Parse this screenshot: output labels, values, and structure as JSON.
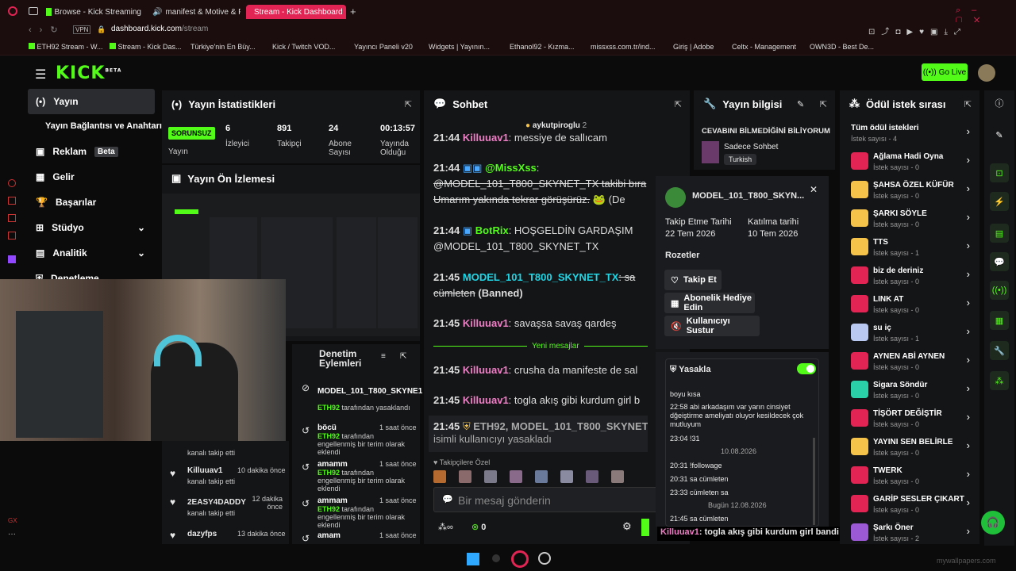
{
  "browser": {
    "tabs": [
      {
        "label": "Browse - Kick Streaming"
      },
      {
        "label": "manifest & Motive & Pa"
      },
      {
        "label": "Stream - Kick Dashboard"
      }
    ],
    "url_host": "dashboard.kick.com",
    "url_path": "/stream",
    "bookmarks": [
      "ETH92 Stream - W...",
      "Stream - Kick Das...",
      "Türkiye'nin En Büy...",
      "Kick / Twitch VOD...",
      "Yayıncı Paneli v20",
      "Widgets | Yayının...",
      "Ethanol92 - Kızma...",
      "missxss.com.tr/ind...",
      "Giriş | Adobe",
      "Celtx - Management",
      "OWN3D - Best De..."
    ]
  },
  "header": {
    "logo": "KICK",
    "beta": "BETA",
    "go_live": "Go Live"
  },
  "sidebar": {
    "items": [
      "Yayın",
      "Yayın Bağlantısı ve Anahtarı",
      "Reklam",
      "Gelir",
      "Başarılar",
      "Stüdyo",
      "Analitik",
      "Denetleme"
    ],
    "beta": "Beta",
    "gx": "GX"
  },
  "stats": {
    "title": "Yayın İstatistikleri",
    "status": "SORUNSUZ",
    "status_label": "Yayın",
    "items": [
      {
        "value": "6",
        "label": "İzleyici"
      },
      {
        "value": "891",
        "label": "Takipçi"
      },
      {
        "value": "24",
        "label": "Abone Sayısı"
      },
      {
        "value": "00:13:57",
        "label": "Yayında Olduğu"
      }
    ]
  },
  "preview": {
    "title": "Yayın Ön İzlemesi"
  },
  "chat": {
    "title": "Sohbet",
    "pinned_user": "aykutpiroglu",
    "pinned_count": "2",
    "lines": [
      {
        "time": "21:44",
        "user": "Killuuav1",
        "text": ": messiye de sallıcam"
      },
      {
        "time": "21:44",
        "user": "@MissXss",
        "text": ":"
      },
      {
        "time": "",
        "user": "",
        "text": "@MODEL_101_T800_SKYNET_TX takibi bıra"
      },
      {
        "time": "",
        "user": "",
        "text": "Umarım yakında tekrar görüşürüz."
      },
      {
        "time": "21:44",
        "user": "BotRix",
        "text": ": HOŞGELDİN GARDAŞIM"
      },
      {
        "time": "",
        "user": "",
        "text": "@MODEL_101_T800_SKYNET_TX"
      },
      {
        "time": "21:45",
        "user": "MODEL_101_T800_SKYNET_TX",
        "text": ": sa"
      },
      {
        "time": "",
        "user": "",
        "text": "cümleten",
        "extra": "(Banned)"
      },
      {
        "time": "21:45",
        "user": "Killuuav1",
        "text": ": savaşsa savaş qardeş"
      },
      {
        "time": "21:45",
        "user": "Killuuav1",
        "text": ": crusha da manifeste de sal"
      },
      {
        "time": "21:45",
        "user": "Killuuav1",
        "text": ": togla akış gibi kurdum girl b"
      }
    ],
    "new_messages": "Yeni mesajlar",
    "ban_time": "21:45",
    "ban_users": "ETH92, MODEL_101_T800_SKYNET_T",
    "ban_text": "isimli kullanıcıyı yasakladı",
    "followers_only": "Takipçilere Özel",
    "input_placeholder": "Bir mesaj gönderin",
    "points": "0"
  },
  "streaminfo": {
    "title": "Yayın bilgisi",
    "stream_title": "CEVABINI BİLMEDİĞİNİ BİLİYORUM",
    "category": "Sadece Sohbet",
    "language": "Turkish"
  },
  "usercard": {
    "name": "MODEL_101_T800_SKYN...",
    "follow_date_label": "Takip Etme Tarihi",
    "follow_date": "22 Tem 2026",
    "join_date_label": "Katılma tarihi",
    "join_date": "10 Tem 2026",
    "badges_label": "Rozetler",
    "follow_btn": "Takip Et",
    "gift_btn": "Abonelik Hediye Edin",
    "mute_btn": "Kullanıcıyı Sustur",
    "ban_label": "Yasakla",
    "history": [
      "boyu kısa",
      "22:58 abi arkadaşım var yarın cinsiyet dğeiştirme ameliyatı oluyor kesildecek çok mutluyum",
      "23:04 !31",
      "10.08.2026",
      "20:31 !followage",
      "20:31 sa cümleten",
      "23:33 cümleten sa",
      "Bugün 12.08.2026",
      "21:45 sa cümleten"
    ]
  },
  "rewards": {
    "title": "Ödül istek sırası",
    "all": "Tüm ödül istekleri",
    "all_count": "İstek sayısı - 4",
    "items": [
      {
        "name": "Ağlama Hadi Oyna",
        "count": "İstek sayısı - 0",
        "color": "#e22454"
      },
      {
        "name": "ŞAHSA ÖZEL KÜFÜR",
        "count": "İstek sayısı - 0",
        "color": "#f5c24a"
      },
      {
        "name": "ŞARKI SÖYLE",
        "count": "İstek sayısı - 0",
        "color": "#f5c24a"
      },
      {
        "name": "TTS",
        "count": "İstek sayısı - 1",
        "color": "#f5c24a"
      },
      {
        "name": "biz de deriniz",
        "count": "İstek sayısı - 0",
        "color": "#e22454"
      },
      {
        "name": "LINK AT",
        "count": "İstek sayısı - 0",
        "color": "#e22454"
      },
      {
        "name": "su iç",
        "count": "İstek sayısı - 1",
        "color": "#b8c8f0"
      },
      {
        "name": "AYNEN ABİ AYNEN",
        "count": "İstek sayısı - 0",
        "color": "#e22454"
      },
      {
        "name": "Sigara Söndür",
        "count": "İstek sayısı - 0",
        "color": "#2ad1a8"
      },
      {
        "name": "TİŞÖRT DEĞİŞTİR",
        "count": "İstek sayısı - 0",
        "color": "#e22454"
      },
      {
        "name": "YAYINI SEN BELİRLE",
        "count": "İstek sayısı - 0",
        "color": "#f5c24a"
      },
      {
        "name": "TWERK",
        "count": "İstek sayısı - 0",
        "color": "#e22454"
      },
      {
        "name": "GARİP SESLER ÇIKART",
        "count": "İstek sayısı - 0",
        "color": "#e22454"
      },
      {
        "name": "Şarkı Öner",
        "count": "İstek sayısı - 2",
        "color": "#9b59d6"
      }
    ]
  },
  "modactions": {
    "title": "Denetim Eylemleri",
    "items": [
      {
        "title": "MODEL_101_T800_SKYNE1",
        "actor": "ETH92",
        "desc": "tarafından yasaklandı",
        "time": ""
      },
      {
        "title": "böcü",
        "actor": "ETH92",
        "desc": "tarafından engellenmiş bir terim olarak eklendi",
        "time": "1 saat önce"
      },
      {
        "title": "amamm",
        "actor": "ETH92",
        "desc": "tarafından engellenmiş bir terim olarak eklendi",
        "time": "1 saat önce"
      },
      {
        "title": "ammam",
        "actor": "ETH92",
        "desc": "tarafından engellenmiş bir terim olarak eklendi",
        "time": "1 saat önce"
      },
      {
        "title": "amam",
        "actor": "",
        "desc": "",
        "time": "1 saat önce"
      }
    ]
  },
  "activity": {
    "items": [
      {
        "name": "",
        "desc": "kanalı takip etti",
        "time": ""
      },
      {
        "name": "Killuuav1",
        "desc": "kanalı takip etti",
        "time": "10 dakika önce"
      },
      {
        "name": "2EASY4DADDY",
        "desc": "kanalı takip etti",
        "time": "12 dakika önce"
      },
      {
        "name": "dazyfps",
        "desc": "",
        "time": "13 dakika önce"
      }
    ]
  },
  "overlay": {
    "chat_user": "Killuuav1",
    "chat_text": ": togla akış gibi kurdum girl bandi",
    "watermark": "mywallpapers.com"
  }
}
